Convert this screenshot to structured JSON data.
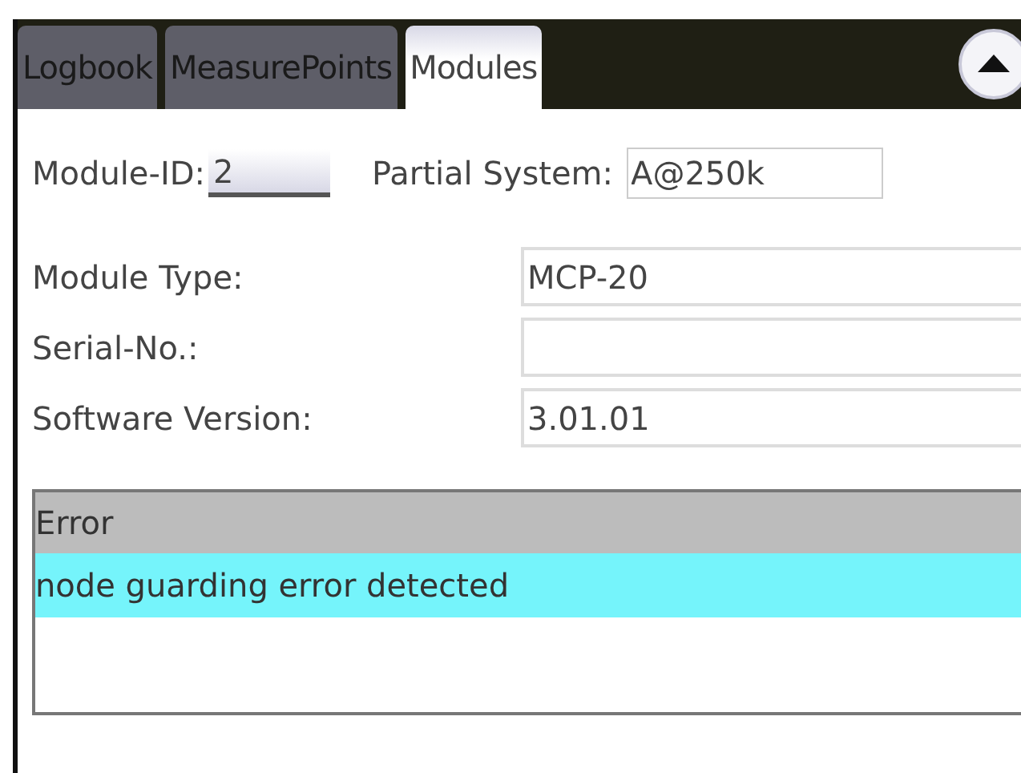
{
  "tabs": [
    {
      "label": "Logbook",
      "selected": false
    },
    {
      "label": "MeasurePoints",
      "selected": false
    },
    {
      "label": "Modules",
      "selected": true
    }
  ],
  "module_id": {
    "label": "Module-ID:",
    "value": "2"
  },
  "partial_system": {
    "label": "Partial System:",
    "value": "A@250k"
  },
  "fields": [
    {
      "label": "Module Type:",
      "value": "MCP-20"
    },
    {
      "label": "Serial-No.:"
    },
    {
      "label": "Software Version:",
      "value": "3.01.01"
    }
  ],
  "error_table": {
    "column": "Error",
    "rows": [
      {
        "text": "node guarding error detected",
        "selected": true
      }
    ]
  }
}
